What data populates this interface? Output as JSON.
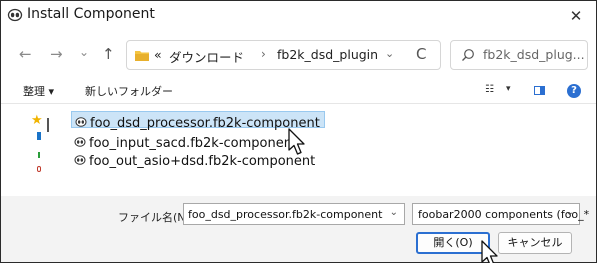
{
  "window": {
    "title": "Install Component",
    "close_label": "✕"
  },
  "nav": {
    "back_label": "←",
    "forward_label": "→",
    "recent_label": "⌄",
    "up_label": "↑",
    "breadcrumb_overflow": "«",
    "breadcrumbs": [
      "ダウンロード",
      "fb2k_dsd_plugin"
    ],
    "separator": "›",
    "address_dropdown": "⌄",
    "refresh_label": "C",
    "search_placeholder": "fb2k_dsd_plug..."
  },
  "commands": {
    "organize": "整理 ▾",
    "new_folder": "新しいフォルダー",
    "view_icon": "☷",
    "view_dropdown": "▾",
    "help_label": "?"
  },
  "files": [
    {
      "name": "foo_dsd_processor.fb2k-component",
      "selected": true,
      "icon": "foobar-component-icon"
    },
    {
      "name": "foo_input_sacd.fb2k-component",
      "selected": false,
      "icon": "foobar-component-icon"
    },
    {
      "name": "foo_out_asio+dsd.fb2k-component",
      "selected": false,
      "icon": "foobar-component-icon"
    }
  ],
  "footer": {
    "filename_label": "ファイル名(N):",
    "filename_value": "foo_dsd_processor.fb2k-component",
    "filename_dropdown": "⌄",
    "filetype_value": "foobar2000 components (foo_*",
    "filetype_dropdown": "⌄",
    "open_button": "開く(O)",
    "cancel_button": "キャンセル"
  },
  "colors": {
    "accent": "#2b6fd1",
    "selection": "#cce4f7",
    "folder": "#f4c542"
  }
}
